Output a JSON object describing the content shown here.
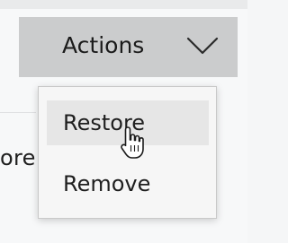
{
  "background": {
    "partial_text": "ore"
  },
  "actions_button": {
    "label": "Actions",
    "icon": "chevron-down-icon"
  },
  "menu": {
    "items": [
      {
        "label": "Restore",
        "hovered": true
      },
      {
        "label": "Remove",
        "hovered": false
      }
    ]
  },
  "cursor": {
    "icon": "hand-pointer-icon"
  },
  "colors": {
    "button_bg": "#cbcccd",
    "menu_bg": "#f6f6f6",
    "hover_bg": "#e6e6e6",
    "text": "#1f1f1f"
  }
}
